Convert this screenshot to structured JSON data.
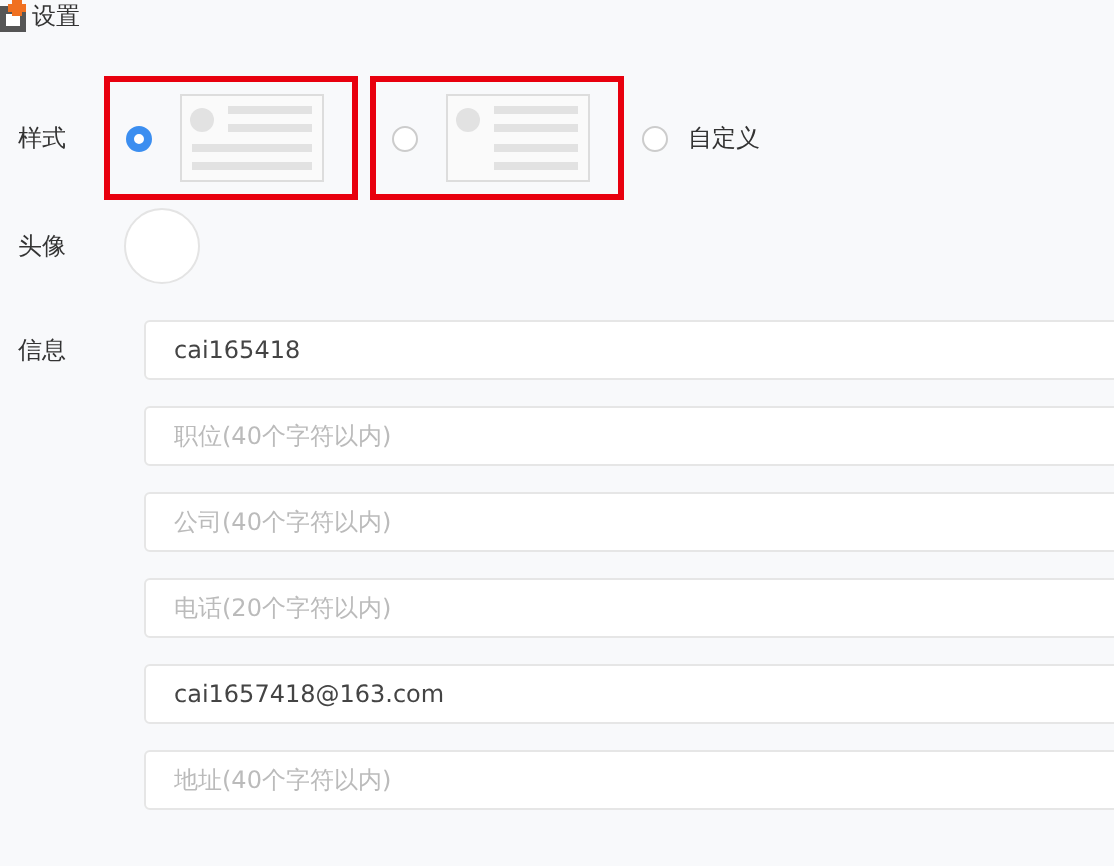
{
  "header": {
    "title": "设置"
  },
  "style": {
    "label": "样式",
    "options": [
      {
        "kind": "wide-preview",
        "selected": true,
        "highlighted": true
      },
      {
        "kind": "compact-preview",
        "selected": false,
        "highlighted": true
      },
      {
        "kind": "text",
        "selected": false,
        "highlighted": false,
        "label": "自定义"
      }
    ]
  },
  "avatar": {
    "label": "头像"
  },
  "info": {
    "label": "信息",
    "fields": [
      {
        "value": "cai165418"
      },
      {
        "placeholder": "职位(40个字符以内)"
      },
      {
        "placeholder": "公司(40个字符以内)"
      },
      {
        "placeholder": "电话(20个字符以内)"
      },
      {
        "value": "cai1657418@163.com"
      },
      {
        "placeholder": "地址(40个字符以内)"
      }
    ]
  }
}
